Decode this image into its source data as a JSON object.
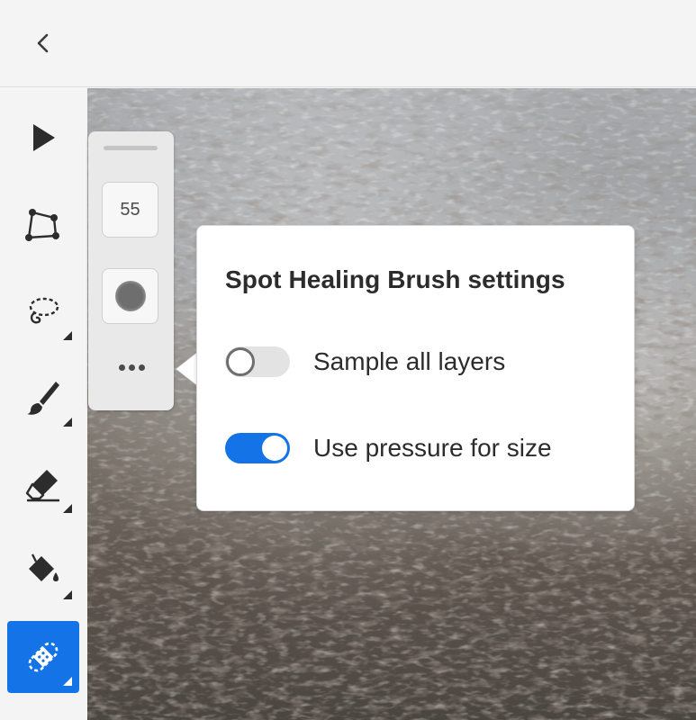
{
  "header": {
    "back_icon": "chevron-left-icon"
  },
  "toolbar": {
    "tools": [
      {
        "name": "select-tool",
        "icon": "arrow-pointer-icon"
      },
      {
        "name": "transform-tool",
        "icon": "polygon-icon"
      },
      {
        "name": "lasso-tool",
        "icon": "lasso-icon"
      },
      {
        "name": "brush-tool",
        "icon": "brush-icon"
      },
      {
        "name": "eraser-tool",
        "icon": "eraser-icon"
      },
      {
        "name": "fill-tool",
        "icon": "paint-bucket-icon"
      },
      {
        "name": "spot-healing-tool",
        "icon": "bandage-icon",
        "active": true
      }
    ],
    "accent_color": "#1473e6"
  },
  "brush_panel": {
    "size_value": "55",
    "hardness_icon": "soft-brush-icon",
    "more_icon": "more-dots-icon"
  },
  "settings_popover": {
    "title": "Spot Healing Brush settings",
    "options": [
      {
        "label": "Sample all layers",
        "enabled": false
      },
      {
        "label": "Use pressure for size",
        "enabled": true
      }
    ]
  }
}
